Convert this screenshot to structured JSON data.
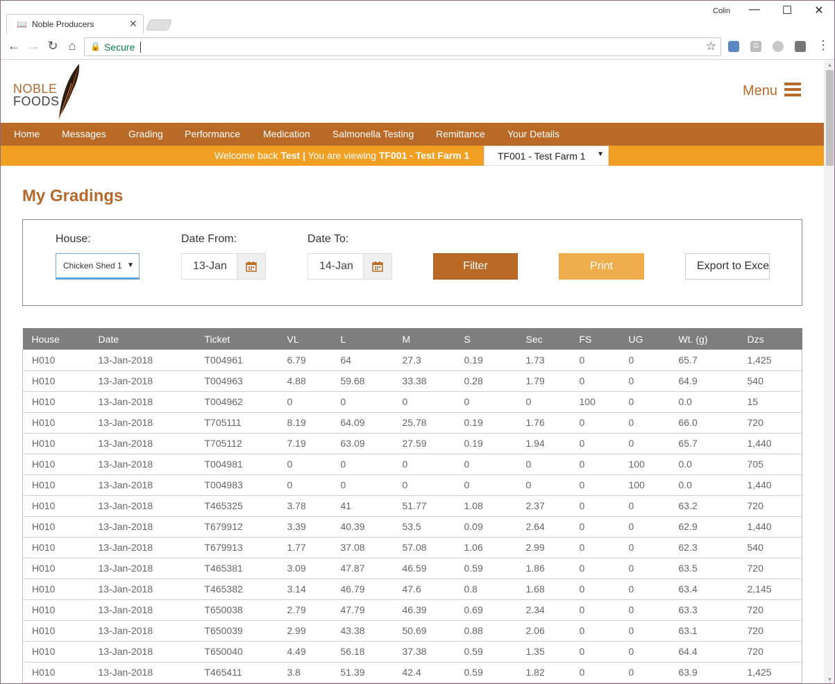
{
  "browser": {
    "tab_title": "Noble Producers",
    "profile_name": "Colin",
    "secure_label": "Secure"
  },
  "site": {
    "logo_line1": "NOBLE",
    "logo_line2": "FOODS",
    "menu_label": "Menu",
    "nav": [
      "Home",
      "Messages",
      "Grading",
      "Performance",
      "Medication",
      "Salmonella Testing",
      "Remittance",
      "Your Details"
    ],
    "welcome": {
      "prefix": "Welcome back ",
      "user": "Test",
      "separator": " | ",
      "viewing": "You are viewing ",
      "farm": "TF001 - Test Farm 1"
    },
    "farm_select_value": "TF001 - Test Farm 1"
  },
  "page": {
    "title": "My Gradings",
    "filters": {
      "house_label": "House:",
      "house_value": "Chicken Shed 1",
      "date_from_label": "Date From:",
      "date_from_value": "13-Jan",
      "date_to_label": "Date To:",
      "date_to_value": "14-Jan",
      "filter_button": "Filter",
      "print_button": "Print",
      "export_button": "Export to Excel"
    }
  },
  "table": {
    "columns": [
      "House",
      "Date",
      "Ticket",
      "VL",
      "L",
      "M",
      "S",
      "Sec",
      "FS",
      "UG",
      "Wt. (g)",
      "Dzs"
    ],
    "rows": [
      [
        "H010",
        "13-Jan-2018",
        "T004961",
        "6.79",
        "64",
        "27.3",
        "0.19",
        "1.73",
        "0",
        "0",
        "65.7",
        "1,425"
      ],
      [
        "H010",
        "13-Jan-2018",
        "T004963",
        "4.88",
        "59.68",
        "33.38",
        "0.28",
        "1.79",
        "0",
        "0",
        "64.9",
        "540"
      ],
      [
        "H010",
        "13-Jan-2018",
        "T004962",
        "0",
        "0",
        "0",
        "0",
        "0",
        "100",
        "0",
        "0.0",
        "15"
      ],
      [
        "H010",
        "13-Jan-2018",
        "T705111",
        "8.19",
        "64.09",
        "25.78",
        "0.19",
        "1.76",
        "0",
        "0",
        "66.0",
        "720"
      ],
      [
        "H010",
        "13-Jan-2018",
        "T705112",
        "7.19",
        "63.09",
        "27.59",
        "0.19",
        "1.94",
        "0",
        "0",
        "65.7",
        "1,440"
      ],
      [
        "H010",
        "13-Jan-2018",
        "T004981",
        "0",
        "0",
        "0",
        "0",
        "0",
        "0",
        "100",
        "0.0",
        "705"
      ],
      [
        "H010",
        "13-Jan-2018",
        "T004983",
        "0",
        "0",
        "0",
        "0",
        "0",
        "0",
        "100",
        "0.0",
        "1,440"
      ],
      [
        "H010",
        "13-Jan-2018",
        "T465325",
        "3.78",
        "41",
        "51.77",
        "1.08",
        "2.37",
        "0",
        "0",
        "63.2",
        "720"
      ],
      [
        "H010",
        "13-Jan-2018",
        "T679912",
        "3.39",
        "40.39",
        "53.5",
        "0.09",
        "2.64",
        "0",
        "0",
        "62.9",
        "1,440"
      ],
      [
        "H010",
        "13-Jan-2018",
        "T679913",
        "1.77",
        "37.08",
        "57.08",
        "1.06",
        "2.99",
        "0",
        "0",
        "62.3",
        "540"
      ],
      [
        "H010",
        "13-Jan-2018",
        "T465381",
        "3.09",
        "47.87",
        "46.59",
        "0.59",
        "1.86",
        "0",
        "0",
        "63.5",
        "720"
      ],
      [
        "H010",
        "13-Jan-2018",
        "T465382",
        "3.14",
        "46.79",
        "47.6",
        "0.8",
        "1.68",
        "0",
        "0",
        "63.4",
        "2,145"
      ],
      [
        "H010",
        "13-Jan-2018",
        "T650038",
        "2.79",
        "47.79",
        "46.39",
        "0.69",
        "2.34",
        "0",
        "0",
        "63.3",
        "720"
      ],
      [
        "H010",
        "13-Jan-2018",
        "T650039",
        "2.99",
        "43.38",
        "50.69",
        "0.88",
        "2.06",
        "0",
        "0",
        "63.1",
        "720"
      ],
      [
        "H010",
        "13-Jan-2018",
        "T650040",
        "4.49",
        "56.18",
        "37.38",
        "0.59",
        "1.35",
        "0",
        "0",
        "64.4",
        "720"
      ],
      [
        "H010",
        "13-Jan-2018",
        "T465411",
        "3.8",
        "51.39",
        "42.4",
        "0.59",
        "1.82",
        "0",
        "0",
        "63.9",
        "1,425"
      ]
    ]
  },
  "colors": {
    "brand_brown": "#b96a26",
    "brand_orange": "#f2a023",
    "table_header": "#7e7e7e"
  }
}
